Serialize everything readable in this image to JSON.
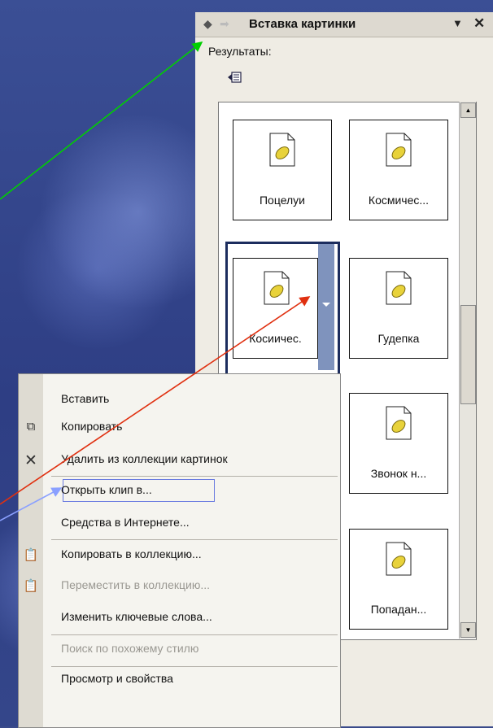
{
  "pane": {
    "title": "Вставка картинки",
    "results_label": "Результаты:"
  },
  "clips": [
    {
      "label": "Поцелуи"
    },
    {
      "label": "Космичес..."
    },
    {
      "label": "Косиичес."
    },
    {
      "label": "Гудепка"
    },
    {
      "label": "Звонок н..."
    },
    {
      "label": "Попадан..."
    }
  ],
  "menu": {
    "items": [
      {
        "label": "Вставить",
        "enabled": true,
        "icon": ""
      },
      {
        "label": "Копировать",
        "enabled": true,
        "icon": "copy-icon"
      },
      {
        "label": "Удалить из коллекции картинок",
        "enabled": true,
        "icon": "delete-icon"
      },
      {
        "label": "Открыть клип в...",
        "enabled": true,
        "icon": ""
      },
      {
        "label": "Средства в Интернете...",
        "enabled": true,
        "icon": ""
      },
      {
        "label": "Копировать в коллекцию...",
        "enabled": true,
        "icon": "copy-to-collection-icon"
      },
      {
        "label": "Переместить в коллекцию...",
        "enabled": false,
        "icon": "move-to-collection-icon"
      },
      {
        "label": "Изменить ключевые слова...",
        "enabled": true,
        "icon": ""
      },
      {
        "label": "Поиск по похожему стилю",
        "enabled": false,
        "icon": ""
      },
      {
        "label": "Просмотр и свойства",
        "enabled": true,
        "icon": ""
      }
    ]
  },
  "colors": {
    "arrow_green": "#00d000",
    "arrow_red": "#e03010",
    "arrow_blue": "#8aa0ff"
  }
}
